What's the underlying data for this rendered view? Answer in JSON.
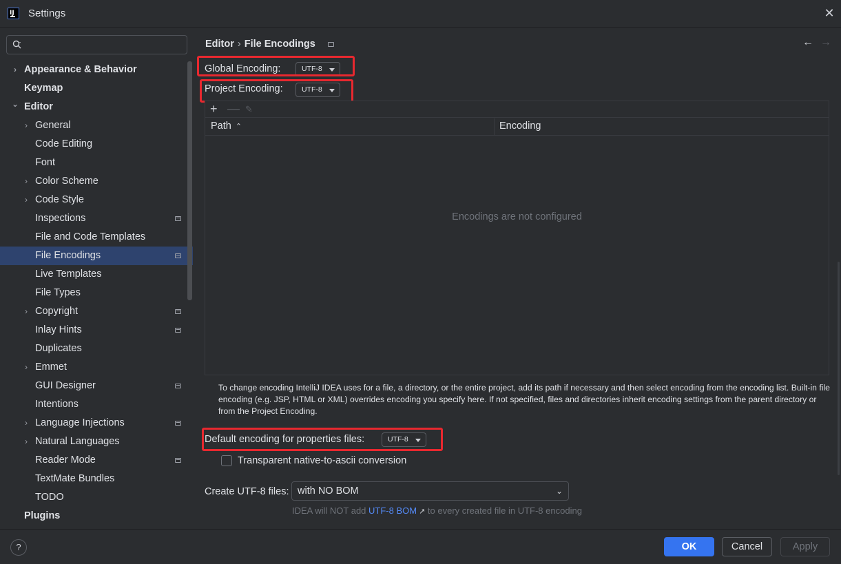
{
  "window": {
    "title": "Settings",
    "app_icon": "intellij-icon",
    "close": "✕"
  },
  "search": {
    "placeholder": ""
  },
  "sidebar": {
    "items": [
      {
        "label": "Appearance & Behavior",
        "level": 0,
        "bold": true,
        "expandable": true,
        "expanded": false,
        "project": false
      },
      {
        "label": "Keymap",
        "level": 0,
        "bold": true,
        "expandable": false,
        "project": false
      },
      {
        "label": "Editor",
        "level": 0,
        "bold": true,
        "expandable": true,
        "expanded": true,
        "project": false
      },
      {
        "label": "General",
        "level": 1,
        "expandable": true,
        "expanded": false,
        "project": false
      },
      {
        "label": "Code Editing",
        "level": 1,
        "expandable": false,
        "project": false
      },
      {
        "label": "Font",
        "level": 1,
        "expandable": false,
        "project": false
      },
      {
        "label": "Color Scheme",
        "level": 1,
        "expandable": true,
        "expanded": false,
        "project": false
      },
      {
        "label": "Code Style",
        "level": 1,
        "expandable": true,
        "expanded": false,
        "project": false
      },
      {
        "label": "Inspections",
        "level": 1,
        "expandable": false,
        "project": true
      },
      {
        "label": "File and Code Templates",
        "level": 1,
        "expandable": false,
        "project": false
      },
      {
        "label": "File Encodings",
        "level": 1,
        "expandable": false,
        "project": true,
        "selected": true
      },
      {
        "label": "Live Templates",
        "level": 1,
        "expandable": false,
        "project": false
      },
      {
        "label": "File Types",
        "level": 1,
        "expandable": false,
        "project": false
      },
      {
        "label": "Copyright",
        "level": 1,
        "expandable": true,
        "expanded": false,
        "project": true
      },
      {
        "label": "Inlay Hints",
        "level": 1,
        "expandable": false,
        "project": true
      },
      {
        "label": "Duplicates",
        "level": 1,
        "expandable": false,
        "project": false
      },
      {
        "label": "Emmet",
        "level": 1,
        "expandable": true,
        "expanded": false,
        "project": false
      },
      {
        "label": "GUI Designer",
        "level": 1,
        "expandable": false,
        "project": true
      },
      {
        "label": "Intentions",
        "level": 1,
        "expandable": false,
        "project": false
      },
      {
        "label": "Language Injections",
        "level": 1,
        "expandable": true,
        "expanded": false,
        "project": true
      },
      {
        "label": "Natural Languages",
        "level": 1,
        "expandable": true,
        "expanded": false,
        "project": false
      },
      {
        "label": "Reader Mode",
        "level": 1,
        "expandable": false,
        "project": true
      },
      {
        "label": "TextMate Bundles",
        "level": 1,
        "expandable": false,
        "project": false
      },
      {
        "label": "TODO",
        "level": 1,
        "expandable": false,
        "project": false
      },
      {
        "label": "Plugins",
        "level": 0,
        "bold": true,
        "expandable": false,
        "project": false
      }
    ]
  },
  "breadcrumb": {
    "parent": "Editor",
    "separator": "›",
    "current": "File Encodings"
  },
  "nav": {
    "back": "←",
    "forward": "→"
  },
  "global_encoding": {
    "label": "Global Encoding:",
    "value": "UTF-8"
  },
  "project_encoding": {
    "label": "Project Encoding:",
    "value": "UTF-8"
  },
  "table": {
    "toolbar": {
      "add": "+",
      "remove": "—",
      "edit": "✎"
    },
    "columns": [
      "Path",
      "Encoding"
    ],
    "sort_icon": "⌃",
    "empty_text": "Encodings are not configured",
    "rows": []
  },
  "help_text": "To change encoding IntelliJ IDEA uses for a file, a directory, or the entire project, add its path if necessary and then select encoding from the encoding list. Built-in file encoding (e.g. JSP, HTML or XML) overrides encoding you specify here. If not specified, files and directories inherit encoding settings from the parent directory or from the Project Encoding.",
  "properties_encoding": {
    "label": "Default encoding for properties files:",
    "value": "UTF-8"
  },
  "native_to_ascii": {
    "label": "Transparent native-to-ascii conversion",
    "checked": false
  },
  "create_utf8": {
    "label": "Create UTF-8 files:",
    "value": "with NO BOM",
    "chevron": "⌄"
  },
  "bom_note": {
    "before": "IDEA will NOT add ",
    "link": "UTF-8 BOM",
    "link_icon": "↗",
    "after": " to every created file in UTF-8 encoding"
  },
  "footer": {
    "help": "?",
    "ok": "OK",
    "cancel": "Cancel",
    "apply": "Apply"
  },
  "colors": {
    "accent": "#3574f0",
    "selection": "#2e436e",
    "highlight_box": "#e8282f",
    "link": "#548af7",
    "background": "#2b2d30"
  }
}
